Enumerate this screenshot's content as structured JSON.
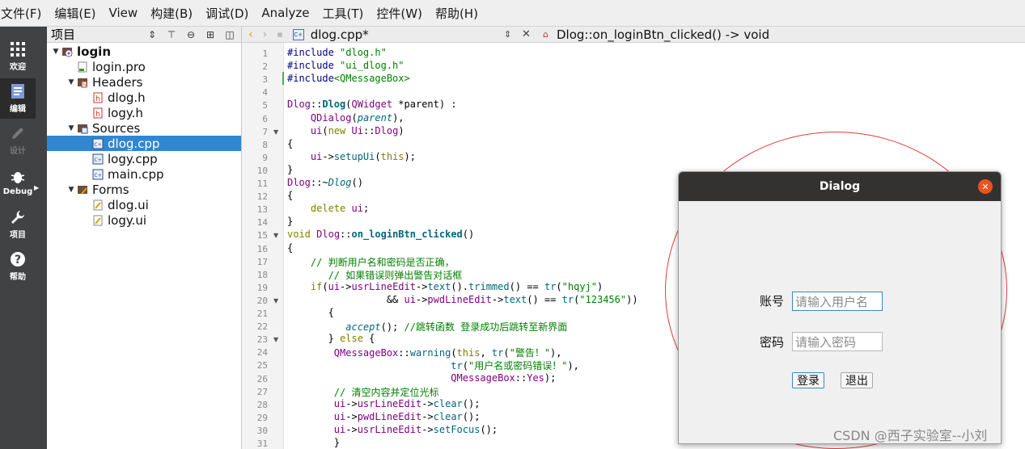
{
  "menubar": {
    "items": [
      "文件(F)",
      "编辑(E)",
      "View",
      "构建(B)",
      "调试(D)",
      "Analyze",
      "工具(T)",
      "控件(W)",
      "帮助(H)"
    ]
  },
  "modes": [
    {
      "label": "欢迎",
      "icon": "grid-icon"
    },
    {
      "label": "编辑",
      "icon": "edit-document-icon"
    },
    {
      "label": "设计",
      "icon": "pencil-icon"
    },
    {
      "label": "Debug",
      "icon": "bug-icon"
    },
    {
      "label": "项目",
      "icon": "wrench-icon"
    },
    {
      "label": "帮助",
      "icon": "help-icon"
    }
  ],
  "project": {
    "title": "项目",
    "tree": [
      {
        "label": "login",
        "level": 0,
        "expanded": true,
        "bold": true,
        "icon": "project-icon"
      },
      {
        "label": "login.pro",
        "level": 1,
        "icon": "pro-file-icon"
      },
      {
        "label": "Headers",
        "level": 1,
        "expanded": true,
        "icon": "folder-headers-icon"
      },
      {
        "label": "dlog.h",
        "level": 2,
        "icon": "header-file-icon"
      },
      {
        "label": "logy.h",
        "level": 2,
        "icon": "header-file-icon"
      },
      {
        "label": "Sources",
        "level": 1,
        "expanded": true,
        "icon": "folder-sources-icon"
      },
      {
        "label": "dlog.cpp",
        "level": 2,
        "icon": "cpp-file-icon",
        "selected": true
      },
      {
        "label": "logy.cpp",
        "level": 2,
        "icon": "cpp-file-icon"
      },
      {
        "label": "main.cpp",
        "level": 2,
        "icon": "cpp-file-icon"
      },
      {
        "label": "Forms",
        "level": 1,
        "expanded": true,
        "icon": "folder-forms-icon"
      },
      {
        "label": "dlog.ui",
        "level": 2,
        "icon": "ui-file-icon"
      },
      {
        "label": "logy.ui",
        "level": 2,
        "icon": "ui-file-icon"
      }
    ]
  },
  "editor": {
    "file_tab": "dlog.cpp*",
    "symbol": "Dlog::on_loginBtn_clicked() -> void",
    "line_numbers": [
      "1",
      "2",
      "3",
      "4",
      "5",
      "6",
      "7",
      "8",
      "9",
      "10",
      "11",
      "12",
      "13",
      "14",
      "15",
      "16",
      "17",
      "18",
      "19",
      "20",
      "21",
      "22",
      "23",
      "24",
      "25",
      "26",
      "27",
      "28",
      "29",
      "30",
      "31"
    ],
    "lines": [
      [
        {
          "c": "pp",
          "t": "#include "
        },
        {
          "c": "str",
          "t": "\"dlog.h\""
        }
      ],
      [
        {
          "c": "pp",
          "t": "#include "
        },
        {
          "c": "str",
          "t": "\"ui_dlog.h\""
        }
      ],
      [
        {
          "c": "pp",
          "t": "#include"
        },
        {
          "c": "str",
          "t": "<QMessageBox>"
        }
      ],
      [],
      [
        {
          "c": "ty",
          "t": "Dlog"
        },
        {
          "c": "",
          "t": "::"
        },
        {
          "c": "bold-fn",
          "t": "Dlog"
        },
        {
          "c": "",
          "t": "("
        },
        {
          "c": "ty",
          "t": "QWidget"
        },
        {
          "c": "",
          "t": " *parent) :"
        }
      ],
      [
        {
          "c": "",
          "t": "    "
        },
        {
          "c": "ty",
          "t": "QDialog"
        },
        {
          "c": "",
          "t": "("
        },
        {
          "c": "it",
          "t": "parent"
        },
        {
          "c": "",
          "t": "),"
        }
      ],
      [
        {
          "c": "",
          "t": "    "
        },
        {
          "c": "ty",
          "t": "ui"
        },
        {
          "c": "",
          "t": "("
        },
        {
          "c": "kw",
          "t": "new"
        },
        {
          "c": "",
          "t": " "
        },
        {
          "c": "ty",
          "t": "Ui"
        },
        {
          "c": "",
          "t": "::"
        },
        {
          "c": "ty",
          "t": "Dlog"
        },
        {
          "c": "",
          "t": ")"
        }
      ],
      [
        {
          "c": "",
          "t": "{"
        }
      ],
      [
        {
          "c": "",
          "t": "    "
        },
        {
          "c": "ty",
          "t": "ui"
        },
        {
          "c": "",
          "t": "->"
        },
        {
          "c": "fn",
          "t": "setupUi"
        },
        {
          "c": "",
          "t": "("
        },
        {
          "c": "kw",
          "t": "this"
        },
        {
          "c": "",
          "t": ");"
        }
      ],
      [
        {
          "c": "",
          "t": "}"
        }
      ],
      [
        {
          "c": "ty",
          "t": "Dlog"
        },
        {
          "c": "",
          "t": "::~"
        },
        {
          "c": "it",
          "t": "Dlog"
        },
        {
          "c": "",
          "t": "()"
        }
      ],
      [
        {
          "c": "",
          "t": "{"
        }
      ],
      [
        {
          "c": "",
          "t": "    "
        },
        {
          "c": "kw",
          "t": "delete"
        },
        {
          "c": "",
          "t": " "
        },
        {
          "c": "ty",
          "t": "ui"
        },
        {
          "c": "",
          "t": ";"
        }
      ],
      [
        {
          "c": "",
          "t": "}"
        }
      ],
      [
        {
          "c": "kw",
          "t": "void"
        },
        {
          "c": "",
          "t": " "
        },
        {
          "c": "ty",
          "t": "Dlog"
        },
        {
          "c": "",
          "t": "::"
        },
        {
          "c": "bold-fn",
          "t": "on_loginBtn_clicked"
        },
        {
          "c": "",
          "t": "()"
        }
      ],
      [
        {
          "c": "",
          "t": "{"
        }
      ],
      [
        {
          "c": "",
          "t": "    "
        },
        {
          "c": "cm",
          "t": "// 判断用户名和密码是否正确，"
        }
      ],
      [
        {
          "c": "",
          "t": "       "
        },
        {
          "c": "cm",
          "t": "// 如果错误则弹出警告对话框"
        }
      ],
      [
        {
          "c": "",
          "t": "    "
        },
        {
          "c": "kw",
          "t": "if"
        },
        {
          "c": "",
          "t": "("
        },
        {
          "c": "ty",
          "t": "ui"
        },
        {
          "c": "",
          "t": "->"
        },
        {
          "c": "ty",
          "t": "usrLineEdit"
        },
        {
          "c": "",
          "t": "->"
        },
        {
          "c": "fn",
          "t": "text"
        },
        {
          "c": "",
          "t": "()."
        },
        {
          "c": "fn",
          "t": "trimmed"
        },
        {
          "c": "",
          "t": "() == "
        },
        {
          "c": "fn",
          "t": "tr"
        },
        {
          "c": "",
          "t": "("
        },
        {
          "c": "str",
          "t": "\"hqyj\""
        },
        {
          "c": "",
          "t": ")"
        }
      ],
      [
        {
          "c": "",
          "t": "                 && "
        },
        {
          "c": "ty",
          "t": "ui"
        },
        {
          "c": "",
          "t": "->"
        },
        {
          "c": "ty",
          "t": "pwdLineEdit"
        },
        {
          "c": "",
          "t": "->"
        },
        {
          "c": "fn",
          "t": "text"
        },
        {
          "c": "",
          "t": "() == "
        },
        {
          "c": "fn",
          "t": "tr"
        },
        {
          "c": "",
          "t": "("
        },
        {
          "c": "str",
          "t": "\"123456\""
        },
        {
          "c": "",
          "t": "))"
        }
      ],
      [
        {
          "c": "",
          "t": "       {"
        }
      ],
      [
        {
          "c": "",
          "t": "          "
        },
        {
          "c": "it",
          "t": "accept"
        },
        {
          "c": "",
          "t": "(); "
        },
        {
          "c": "cm",
          "t": "//跳转函数 登录成功后跳转至新界面"
        }
      ],
      [
        {
          "c": "",
          "t": "       } "
        },
        {
          "c": "kw",
          "t": "else"
        },
        {
          "c": "",
          "t": " {"
        }
      ],
      [
        {
          "c": "",
          "t": "        "
        },
        {
          "c": "ty",
          "t": "QMessageBox"
        },
        {
          "c": "",
          "t": "::"
        },
        {
          "c": "fn",
          "t": "warning"
        },
        {
          "c": "",
          "t": "("
        },
        {
          "c": "kw",
          "t": "this"
        },
        {
          "c": "",
          "t": ", "
        },
        {
          "c": "fn",
          "t": "tr"
        },
        {
          "c": "",
          "t": "("
        },
        {
          "c": "str",
          "t": "\"警告！\""
        },
        {
          "c": "",
          "t": "),"
        }
      ],
      [
        {
          "c": "",
          "t": "                            "
        },
        {
          "c": "fn",
          "t": "tr"
        },
        {
          "c": "",
          "t": "("
        },
        {
          "c": "str",
          "t": "\"用户名或密码错误！\""
        },
        {
          "c": "",
          "t": "),"
        }
      ],
      [
        {
          "c": "",
          "t": "                            "
        },
        {
          "c": "ty",
          "t": "QMessageBox"
        },
        {
          "c": "",
          "t": "::"
        },
        {
          "c": "ty",
          "t": "Yes"
        },
        {
          "c": "",
          "t": ");"
        }
      ],
      [
        {
          "c": "",
          "t": "        "
        },
        {
          "c": "cm",
          "t": "// 清空内容并定位光标"
        }
      ],
      [
        {
          "c": "",
          "t": "        "
        },
        {
          "c": "ty",
          "t": "ui"
        },
        {
          "c": "",
          "t": "->"
        },
        {
          "c": "ty",
          "t": "usrLineEdit"
        },
        {
          "c": "",
          "t": "->"
        },
        {
          "c": "fn",
          "t": "clear"
        },
        {
          "c": "",
          "t": "();"
        }
      ],
      [
        {
          "c": "",
          "t": "        "
        },
        {
          "c": "ty",
          "t": "ui"
        },
        {
          "c": "",
          "t": "->"
        },
        {
          "c": "ty",
          "t": "pwdLineEdit"
        },
        {
          "c": "",
          "t": "->"
        },
        {
          "c": "fn",
          "t": "clear"
        },
        {
          "c": "",
          "t": "();"
        }
      ],
      [
        {
          "c": "",
          "t": "        "
        },
        {
          "c": "ty",
          "t": "ui"
        },
        {
          "c": "",
          "t": "->"
        },
        {
          "c": "ty",
          "t": "usrLineEdit"
        },
        {
          "c": "",
          "t": "->"
        },
        {
          "c": "fn",
          "t": "setFocus"
        },
        {
          "c": "",
          "t": "();"
        }
      ],
      [
        {
          "c": "",
          "t": "        }"
        }
      ]
    ]
  },
  "dialog": {
    "title": "Dialog",
    "account_label": "账号",
    "account_placeholder": "请输入用户名",
    "password_label": "密码",
    "password_placeholder": "请输入密码",
    "login_button": "登录",
    "exit_button": "退出"
  },
  "watermark": "CSDN @西子实验室--小刘",
  "colors": {
    "accent": "#2f86d1",
    "close": "#e95420",
    "circle": "#e23b3b"
  }
}
